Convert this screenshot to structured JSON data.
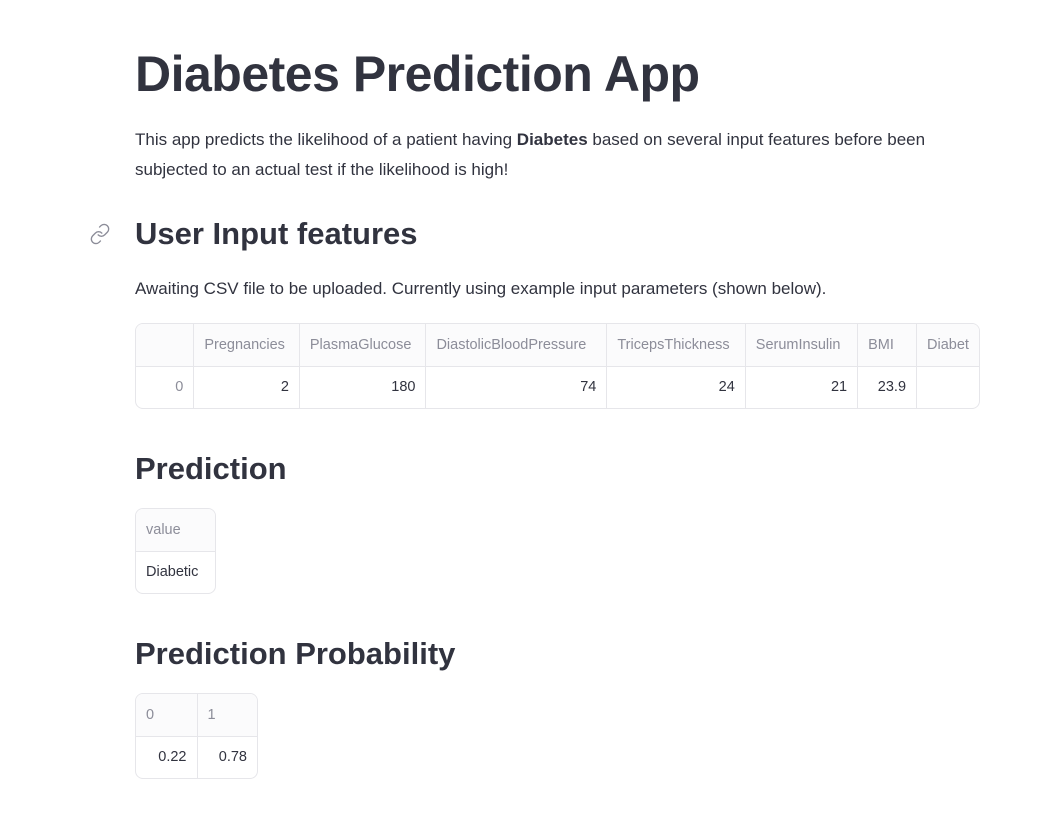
{
  "page": {
    "title": "Diabetes Prediction App",
    "intro_before": "This app predicts the likelihood of a patient having ",
    "intro_bold": "Diabetes",
    "intro_after": " based on several input features before been subjected to an actual test if the likelihood is high!"
  },
  "user_input": {
    "heading": "User Input features",
    "note": "Awaiting CSV file to be uploaded. Currently using example input parameters (shown below).",
    "table": {
      "columns": [
        "",
        "Pregnancies",
        "PlasmaGlucose",
        "DiastolicBloodPressure",
        "TricepsThickness",
        "SerumInsulin",
        "BMI",
        "Diabet"
      ],
      "rows": [
        [
          "0",
          "2",
          "180",
          "74",
          "24",
          "21",
          "23.9",
          ""
        ]
      ]
    }
  },
  "prediction": {
    "heading": "Prediction",
    "table": {
      "columns": [
        "value"
      ],
      "rows": [
        [
          "Diabetic"
        ]
      ]
    }
  },
  "probability": {
    "heading": "Prediction Probability",
    "table": {
      "columns": [
        "0",
        "1"
      ],
      "rows": [
        [
          "0.22",
          "0.78"
        ]
      ]
    }
  },
  "icons": {
    "anchor": "link-icon"
  }
}
